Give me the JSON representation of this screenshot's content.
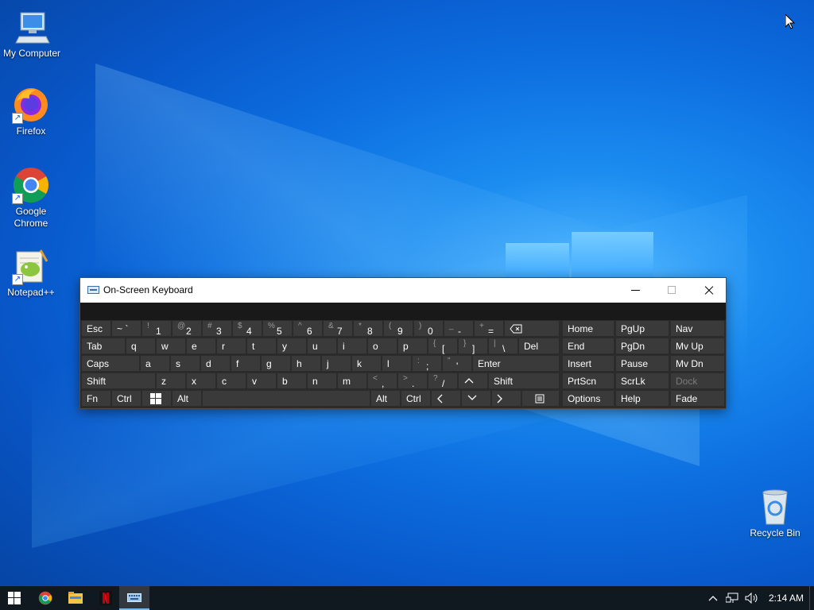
{
  "desktop": {
    "icons": [
      {
        "label": "My Computer"
      },
      {
        "label": "Firefox"
      },
      {
        "label": "Google Chrome"
      },
      {
        "label": "Notepad++"
      },
      {
        "label": "Recycle Bin"
      }
    ]
  },
  "osk": {
    "title": "On-Screen Keyboard",
    "controls": {
      "minimize": "minimize-icon",
      "maximize": "maximize-icon",
      "close": "close-icon"
    },
    "rows": {
      "r1": [
        "Esc",
        "~",
        "`",
        "!",
        "1",
        "@",
        "2",
        "#",
        "3",
        "$",
        "4",
        "%",
        "5",
        "^",
        "6",
        "&",
        "7",
        "*",
        "8",
        "(",
        "9",
        ")",
        "0",
        "_",
        "-",
        "+",
        "=",
        "backspace-icon"
      ],
      "r2": [
        "Tab",
        "q",
        "w",
        "e",
        "r",
        "t",
        "y",
        "u",
        "i",
        "o",
        "p",
        "{",
        "[",
        "}",
        "]",
        "|",
        "\\",
        "Del"
      ],
      "r3": [
        "Caps",
        "a",
        "s",
        "d",
        "f",
        "g",
        "h",
        "j",
        "k",
        "l",
        ":",
        ";",
        "\"",
        "'",
        "Enter"
      ],
      "r4": [
        "Shift",
        "z",
        "x",
        "c",
        "v",
        "b",
        "n",
        "m",
        "<",
        ",",
        ">",
        ".",
        "?",
        "/",
        "^",
        "Shift"
      ],
      "r5": [
        "Fn",
        "Ctrl",
        "windows-icon",
        "Alt",
        "Alt",
        "Ctrl",
        "<",
        "v",
        ">",
        "menu-icon"
      ]
    },
    "nav": {
      "c1": [
        "Home",
        "End",
        "Insert",
        "PrtScn",
        "Options"
      ],
      "c2": [
        "PgUp",
        "PgDn",
        "Pause",
        "ScrLk",
        "Help"
      ],
      "c3": [
        "Nav",
        "Mv Up",
        "Mv Dn",
        "Dock",
        "Fade"
      ]
    }
  },
  "taskbar": {
    "items": [
      "start-icon",
      "chrome-icon",
      "file-explorer-icon",
      "netflix-icon",
      "keyboard-icon"
    ],
    "tray": {
      "clock": "2:14 AM",
      "icons": [
        "chevron-up-icon",
        "network-icon",
        "volume-icon"
      ]
    }
  }
}
